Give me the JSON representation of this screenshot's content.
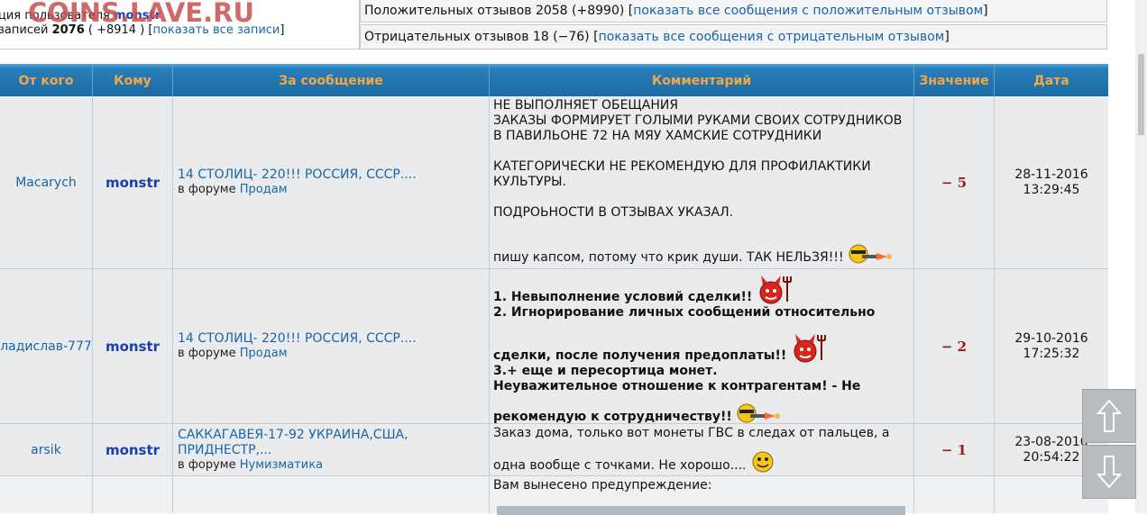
{
  "watermark": "COINS.LAVE.RU",
  "summary": {
    "reputation_prefix": "ция пользователя",
    "user": "monstr",
    "records_prefix": "записей",
    "records_total": "2076",
    "records_delta": "( +8914 )",
    "show_all_records": "показать все записи"
  },
  "feedback": {
    "positive_text": "Положительных отзывов 2058 (+8990)",
    "positive_link": "показать все сообщения с положительным отзывом",
    "negative_text": "Отрицательных отзывов 18 (−76)",
    "negative_link": "показать все сообщения с отрицательным отзывом"
  },
  "table": {
    "headers": [
      "От кого",
      "Кому",
      "За сообщение",
      "Комментарий",
      "Значение",
      "Дата"
    ],
    "forum_prefix": "в форуме",
    "rows": [
      {
        "from": "Macarych",
        "to": "monstr",
        "topic": "14 СТОЛИЦ- 220!!! РОССИЯ, СССР....",
        "forum": "Продам",
        "comment": [
          "НЕ ВЫПОЛНЯЕТ ОБЕЩАНИЯ",
          "ЗАКАЗЫ ФОРМИРУЕТ ГОЛЫМИ РУКАМИ СВОИХ СОТРУДНИКОВ",
          "В ПАВИЛЬОНЕ 72 НА МЯУ ХАМСКИЕ СОТРУДНИКИ",
          "КАТЕГОРИЧЕСКИ НЕ РЕКОМЕНДУЮ ДЛЯ ПРОФИЛАКТИКИ",
          "КУЛЬТУРЫ.",
          "ПОДРОЬНОСТИ В ОТЗЫВАХ УКАЗАЛ.",
          "пишу капсом, потому что крик души. ТАК НЕЛЬЗЯ!!!"
        ],
        "value": "− 5",
        "date": "28-11-2016",
        "time": "13:29:45"
      },
      {
        "from": "ладислав-777",
        "to": "monstr",
        "topic": "14 СТОЛИЦ- 220!!! РОССИЯ, СССР....",
        "forum": "Продам",
        "comment": [
          "1. Невыполнение условий сделки!!",
          "2. Игнорирование личных сообщений относительно",
          "сделки, после получения предоплаты!!",
          "3.+ еще и пересортица монет.",
          "Неуважительное отношение к контрагентам! - Не",
          "рекомендую к сотрудничеству!!"
        ],
        "value": "− 2",
        "date": "29-10-2016",
        "time": "17:25:32"
      },
      {
        "from": "arsik",
        "to": "monstr",
        "topic": "САККАГАВЕЯ-17-92 УКРАИНА,США, ПРИДНЕСТР,...",
        "forum": "Нумизматика",
        "comment": [
          "Заказ дома, только вот монеты ГВС в следах от пальцев, а",
          "одна вообще с точками. Не хорошо...."
        ],
        "value": "− 1",
        "date": "23-08-2016",
        "time": "20:54:22"
      },
      {
        "comment": [
          "Вам вынесено предупреждение:"
        ]
      }
    ]
  },
  "icons": {
    "smiley_shooter": "smiley-gun-icon",
    "devil": "devil-smiley-icon",
    "grin": "grin-smiley-icon",
    "scroll_up": "arrow-up-icon",
    "scroll_down": "arrow-down-icon"
  },
  "colors": {
    "header_bg": "#1b6aa3",
    "header_text": "#f2a84a",
    "link": "#1a64a8",
    "user": "#1a3fae",
    "negative_value": "#9a1c1c",
    "row_bg": "#e9ebed"
  }
}
